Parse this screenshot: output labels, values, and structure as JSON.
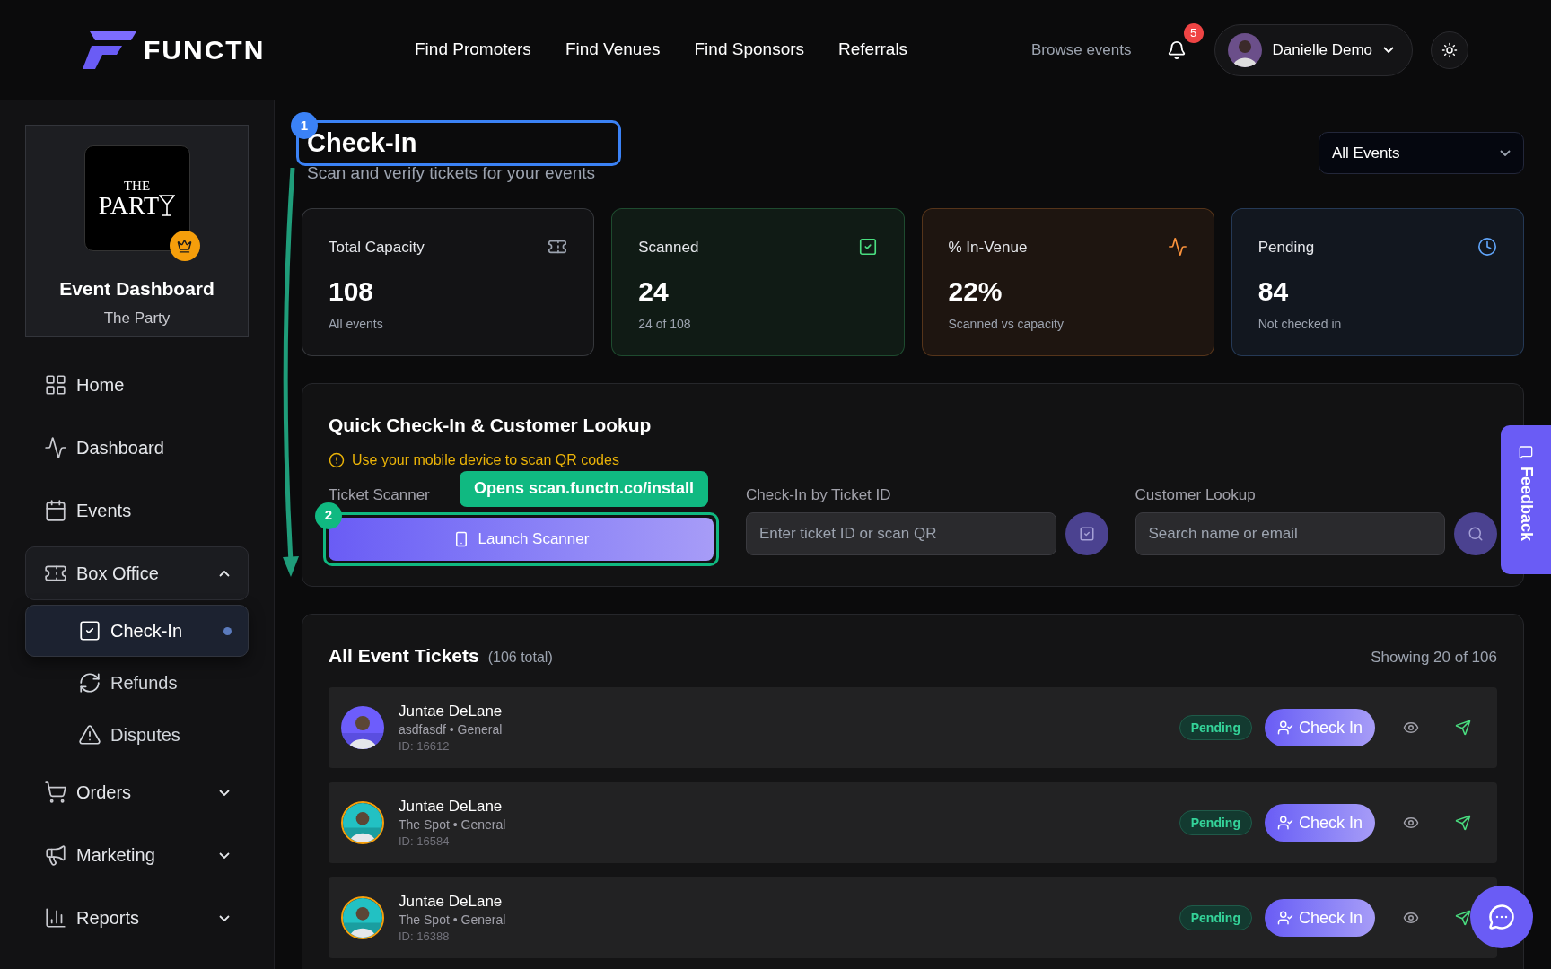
{
  "brand": {
    "name": "FUNCTN"
  },
  "nav": [
    "Find Promoters",
    "Find Venues",
    "Find Sponsors",
    "Referrals"
  ],
  "browse_link": "Browse events",
  "notifications": {
    "count": "5"
  },
  "user": {
    "name": "Danielle Demo"
  },
  "sidebar": {
    "event_card": {
      "logo_top": "THE",
      "logo_main": "PART",
      "title": "Event Dashboard",
      "subtitle": "The Party"
    },
    "items": [
      {
        "label": "Home",
        "kind": "link"
      },
      {
        "label": "Dashboard",
        "kind": "link"
      },
      {
        "label": "Events",
        "kind": "link"
      },
      {
        "label": "Box Office",
        "kind": "group",
        "expanded": true,
        "children": [
          {
            "label": "Check-In",
            "selected": true
          },
          {
            "label": "Refunds",
            "selected": false
          },
          {
            "label": "Disputes",
            "selected": false
          }
        ]
      },
      {
        "label": "Orders",
        "kind": "group",
        "expanded": false
      },
      {
        "label": "Marketing",
        "kind": "group",
        "expanded": false
      },
      {
        "label": "Reports",
        "kind": "group",
        "expanded": false
      }
    ]
  },
  "page": {
    "title": "Check-In",
    "subtitle": "Scan and verify tickets for your events",
    "event_filter": "All Events"
  },
  "stats": [
    {
      "label": "Total Capacity",
      "value": "108",
      "note": "All events",
      "color": "#9ca3af"
    },
    {
      "label": "Scanned",
      "value": "24",
      "note": "24 of 108",
      "color": "#4ade80"
    },
    {
      "label": "% In-Venue",
      "value": "22%",
      "note": "Scanned vs capacity",
      "color": "#fb923c"
    },
    {
      "label": "Pending",
      "value": "84",
      "note": "Not checked in",
      "color": "#60a5fa"
    }
  ],
  "quick_lookup": {
    "title": "Quick Check-In & Customer Lookup",
    "notice": "Use your mobile device to scan QR codes",
    "scanner_label": "Ticket Scanner",
    "scanner_button": "Launch Scanner",
    "ticket_id": {
      "label": "Check-In by Ticket ID",
      "placeholder": "Enter ticket ID or scan QR"
    },
    "customer": {
      "label": "Customer Lookup",
      "placeholder": "Search name or email"
    }
  },
  "tour": {
    "steps": [
      "1",
      "2"
    ],
    "tooltip": "Opens scan.functn.co/install"
  },
  "feedback": "Feedback",
  "tickets": {
    "title": "All Event Tickets",
    "count": "(106 total)",
    "showing": "Showing 20 of 106",
    "rows": [
      {
        "name": "Juntae DeLane",
        "meta": "asdfasdf • General",
        "id": "ID: 16612",
        "status": "Pending",
        "action": "Check In"
      },
      {
        "name": "Juntae DeLane",
        "meta": "The Spot • General",
        "id": "ID: 16584",
        "status": "Pending",
        "action": "Check In"
      },
      {
        "name": "Juntae DeLane",
        "meta": "The Spot • General",
        "id": "ID: 16388",
        "status": "Pending",
        "action": "Check In"
      }
    ]
  }
}
